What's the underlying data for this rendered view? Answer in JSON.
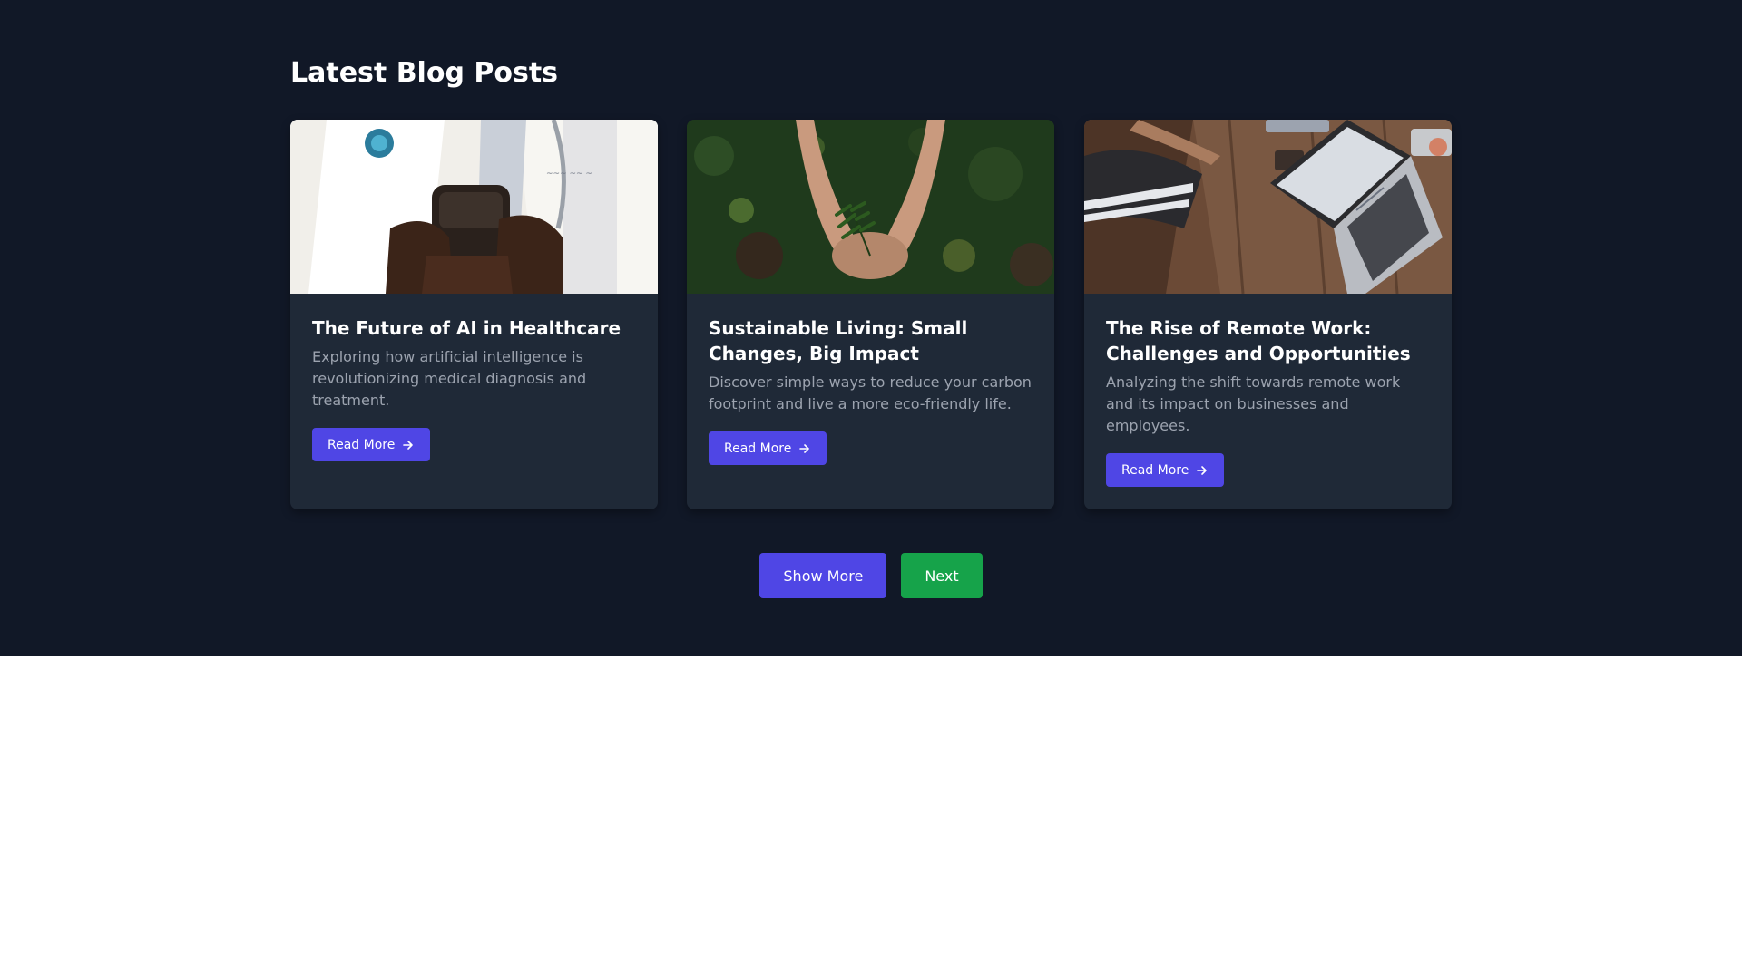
{
  "section": {
    "heading": "Latest Blog Posts"
  },
  "posts": [
    {
      "title": "The Future of AI in Healthcare",
      "excerpt": "Exploring how artificial intelligence is revolutionizing medical diagnosis and treatment.",
      "button_label": "Read More",
      "image_alt": "doctor-holding-smartphone"
    },
    {
      "title": "Sustainable Living: Small Changes, Big Impact",
      "excerpt": "Discover simple ways to reduce your carbon footprint and live a more eco-friendly life.",
      "button_label": "Read More",
      "image_alt": "hands-holding-plant"
    },
    {
      "title": "The Rise of Remote Work: Challenges and Opportunities",
      "excerpt": "Analyzing the shift towards remote work and its impact on businesses and employees.",
      "button_label": "Read More",
      "image_alt": "person-working-on-laptop"
    }
  ],
  "actions": {
    "show_more_label": "Show More",
    "next_label": "Next"
  },
  "colors": {
    "background": "#111827",
    "card": "#1f2937",
    "accent": "#4f46e5",
    "success": "#16a34a",
    "muted_text": "#9ca3af"
  },
  "icons": {
    "read_more": "arrow-right-icon"
  }
}
